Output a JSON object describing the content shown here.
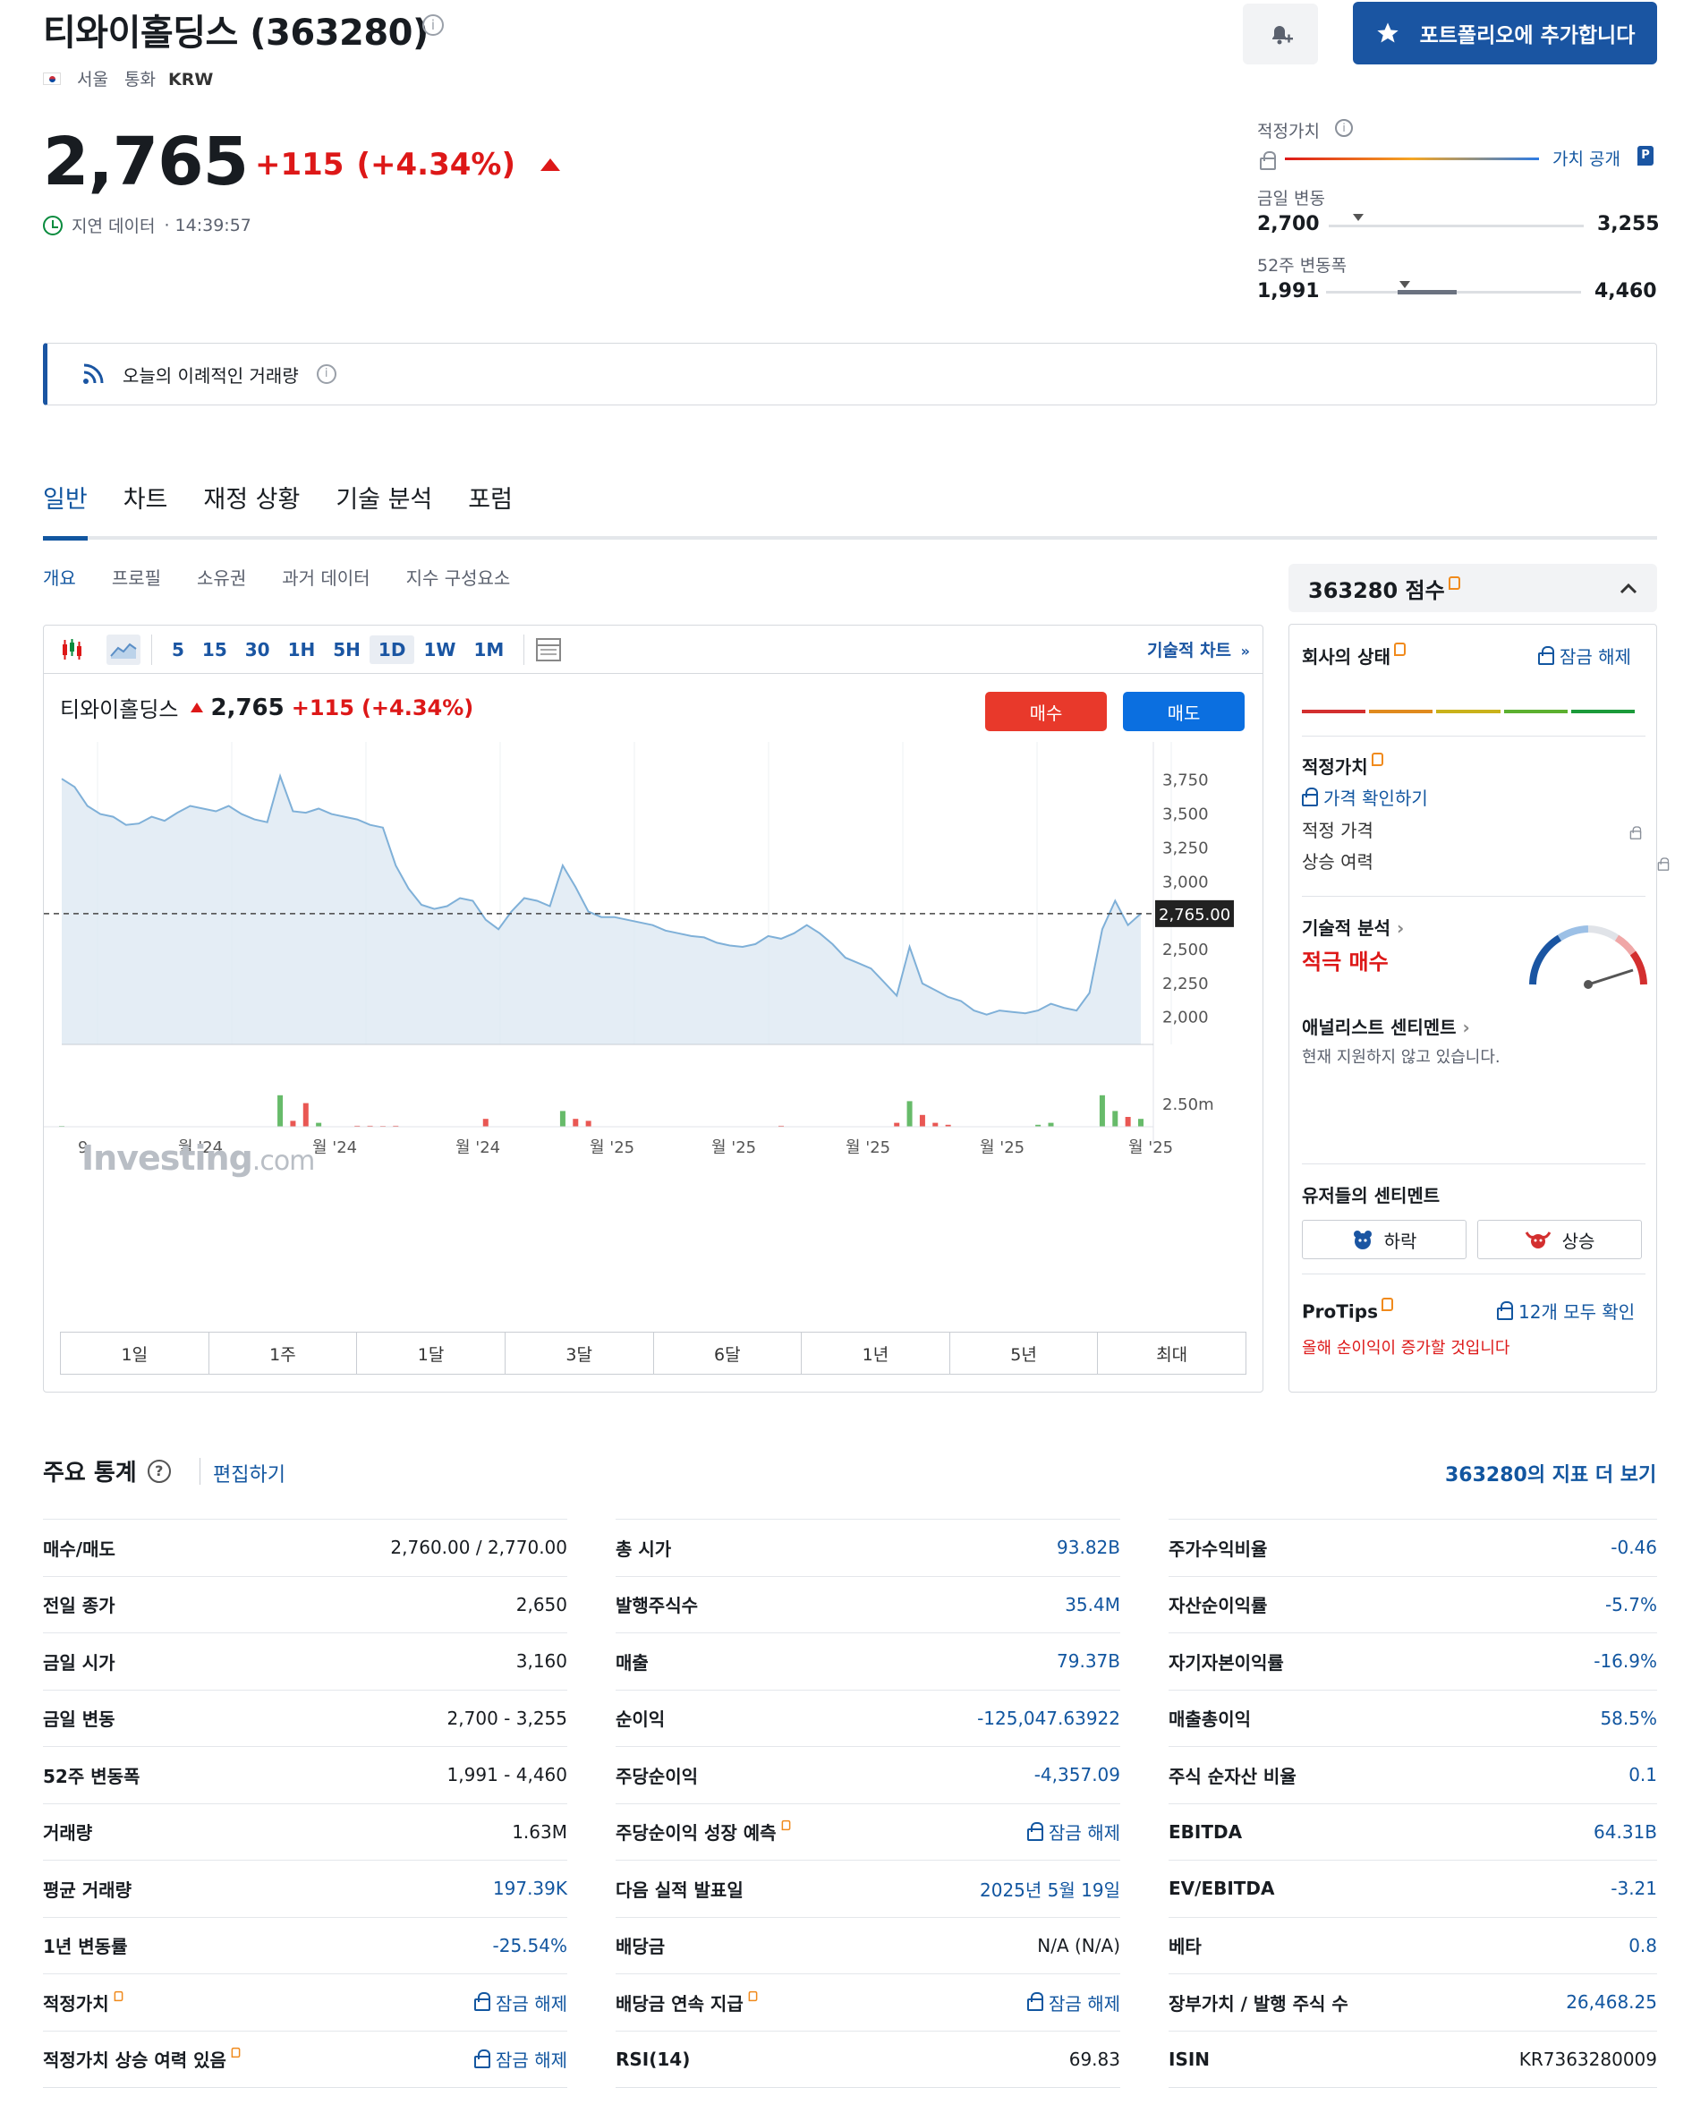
{
  "header": {
    "title": "티와이홀딩스 (363280)",
    "exchange": "서울",
    "currency_label": "통화",
    "currency": "KRW",
    "portfolio_button": "포트폴리오에 추가합니다"
  },
  "quote": {
    "price": "2,765",
    "change": "+115",
    "change_pct": "(+4.34%)",
    "delay_label": "지연 데이터",
    "time": "· 14:39:57"
  },
  "ranges": {
    "fair_value_label": "적정가치",
    "fair_value_link": "가치 공개",
    "day_label": "금일 변동",
    "day_low": "2,700",
    "day_high": "3,255",
    "week52_label": "52주 변동폭",
    "week52_low": "1,991",
    "week52_high": "4,460"
  },
  "banner": {
    "text": "오늘의 이례적인 거래량"
  },
  "tabs": [
    "일반",
    "차트",
    "재정 상황",
    "기술 분석",
    "포럼"
  ],
  "subtabs": [
    "개요",
    "프로필",
    "소유권",
    "과거 데이터",
    "지수 구성요소"
  ],
  "chart": {
    "toolbar_intervals": [
      "5",
      "15",
      "30",
      "1H",
      "5H",
      "1D",
      "1W",
      "1M"
    ],
    "tech_chart_link": "기술적 차트",
    "name": "티와이홀딩스",
    "price": "2,765",
    "change": "+115",
    "change_pct": "(+4.34%)",
    "buy": "매수",
    "sell": "매도",
    "current_label": "2,765.00",
    "watermark": "Investing",
    "watermark_suffix": ".com",
    "periods": [
      "1일",
      "1주",
      "1달",
      "3달",
      "6달",
      "1년",
      "5년",
      "최대"
    ],
    "volume_tick": "2.50m",
    "x_ticks": [
      "9",
      "월 '24",
      "월 '24",
      "월 '24",
      "월 '25",
      "월 '25",
      "월 '25",
      "월 '25",
      "월 '25"
    ],
    "colors": {
      "line": "#7fb0d8",
      "area": "#dde8f3",
      "up": "#4caf50",
      "down": "#e53935"
    }
  },
  "chart_data": {
    "type": "area",
    "ylim": [
      1800,
      3900
    ],
    "y_ticks": [
      "3,750",
      "3,500",
      "3,250",
      "3,000",
      "2,500",
      "2,250",
      "2,000"
    ],
    "y_tick_values": [
      3750,
      3500,
      3250,
      3000,
      2500,
      2250,
      2000
    ],
    "current_value": 2765,
    "values": [
      3760,
      3700,
      3560,
      3500,
      3480,
      3420,
      3430,
      3480,
      3450,
      3510,
      3560,
      3540,
      3520,
      3560,
      3500,
      3460,
      3440,
      3780,
      3520,
      3510,
      3540,
      3500,
      3480,
      3460,
      3420,
      3400,
      3120,
      2950,
      2830,
      2800,
      2820,
      2880,
      2860,
      2720,
      2650,
      2780,
      2880,
      2860,
      2820,
      3120,
      2960,
      2780,
      2740,
      2740,
      2720,
      2700,
      2680,
      2640,
      2620,
      2600,
      2590,
      2550,
      2530,
      2520,
      2540,
      2600,
      2580,
      2620,
      2680,
      2620,
      2540,
      2440,
      2400,
      2360,
      2260,
      2160,
      2520,
      2250,
      2200,
      2150,
      2120,
      2050,
      2020,
      2050,
      2040,
      2030,
      2050,
      2100,
      2070,
      2050,
      2180,
      2650,
      2860,
      2680,
      2765
    ],
    "volume_values": [
      0.04,
      0.02,
      0,
      0,
      0,
      0,
      0,
      0,
      0,
      0,
      0,
      0,
      0,
      0,
      0.01,
      0,
      0.02,
      1.6,
      0.3,
      1.2,
      0.2,
      0,
      0,
      0.05,
      0.05,
      0.04,
      0.05,
      0,
      0,
      0,
      0,
      0,
      0,
      0.4,
      0,
      0,
      0,
      0,
      0,
      0.8,
      0.4,
      0.3,
      0,
      0,
      0,
      0,
      0,
      0,
      0,
      0,
      0,
      0,
      0,
      0,
      0,
      0,
      0.05,
      0,
      0,
      0,
      0,
      0,
      0,
      0,
      0,
      0.2,
      1.3,
      0.6,
      0.2,
      0.1,
      0,
      0,
      0,
      0,
      0,
      0,
      0.1,
      0.2,
      0,
      0,
      0,
      1.6,
      0.8,
      0.5,
      0.4
    ]
  },
  "score": {
    "title": "363280 점수",
    "company_status": "회사의 상태",
    "unlock": "잠금 해제",
    "fair_value": "적정가치",
    "check_price": "가격 확인하기",
    "fair_price": "적정 가격",
    "upside": "상승 여력",
    "tech_analysis": "기술적 분석",
    "tech_signal": "적극 매수",
    "analyst": "애널리스트 센티멘트",
    "analyst_note": "현재 지원하지 않고 있습니다.",
    "user_sentiment": "유저들의 센티멘트",
    "bear": "하락",
    "bull": "상승",
    "protips": "ProTips",
    "protips_all": "12개 모두 확인",
    "protips_tip": "올해 순이익이 증가할 것입니다"
  },
  "stats": {
    "title": "주요 통계",
    "edit": "편집하기",
    "more": "363280의 지표 더 보기",
    "col1": [
      {
        "k": "매수/매도",
        "v": "2,760.00  /  2,770.00",
        "link": false
      },
      {
        "k": "전일 종가",
        "v": "2,650",
        "link": false
      },
      {
        "k": "금일 시가",
        "v": "3,160",
        "link": false
      },
      {
        "k": "금일 변동",
        "v": "2,700 - 3,255",
        "link": false
      },
      {
        "k": "52주 변동폭",
        "v": "1,991 - 4,460",
        "link": false
      },
      {
        "k": "거래량",
        "v": "1.63M",
        "link": false
      },
      {
        "k": "평균 거래량",
        "v": "197.39K",
        "link": true
      },
      {
        "k": "1년 변동률",
        "v": "-25.54%",
        "link": true
      },
      {
        "k": "적정가치",
        "v": "잠금 해제",
        "link": true,
        "pro": true,
        "lock": true
      },
      {
        "k": "적정가치 상승 여력 있음",
        "v": "잠금 해제",
        "link": true,
        "pro": true,
        "lock": true
      }
    ],
    "col2": [
      {
        "k": "총 시가",
        "v": "93.82B",
        "link": true
      },
      {
        "k": "발행주식수",
        "v": "35.4M",
        "link": true
      },
      {
        "k": "매출",
        "v": "79.37B",
        "link": true
      },
      {
        "k": "순이익",
        "v": "-125,047.63922",
        "link": true
      },
      {
        "k": "주당순이익",
        "v": "-4,357.09",
        "link": true
      },
      {
        "k": "주당순이익 성장 예측",
        "v": "잠금 해제",
        "link": true,
        "pro": true,
        "lock": true
      },
      {
        "k": "다음 실적 발표일",
        "v": "2025년 5월 19일",
        "link": true
      },
      {
        "k": "배당금",
        "v": "N/A (N/A)",
        "link": false
      },
      {
        "k": "배당금 연속 지급",
        "v": "잠금 해제",
        "link": true,
        "pro": true,
        "lock": true
      },
      {
        "k": "RSI(14)",
        "v": "69.83",
        "link": false
      }
    ],
    "col3": [
      {
        "k": "주가수익비율",
        "v": "-0.46",
        "link": true
      },
      {
        "k": "자산순이익률",
        "v": "-5.7%",
        "link": true
      },
      {
        "k": "자기자본이익률",
        "v": "-16.9%",
        "link": true
      },
      {
        "k": "매출총이익",
        "v": "58.5%",
        "link": true
      },
      {
        "k": "주식 순자산 비율",
        "v": "0.1",
        "link": true
      },
      {
        "k": "EBITDA",
        "v": "64.31B",
        "link": true
      },
      {
        "k": "EV/EBITDA",
        "v": "-3.21",
        "link": true
      },
      {
        "k": "베타",
        "v": "0.8",
        "link": true
      },
      {
        "k": "장부가치 / 발행 주식 수",
        "v": "26,468.25",
        "link": true
      },
      {
        "k": "ISIN",
        "v": "KR7363280009",
        "link": false
      }
    ]
  }
}
